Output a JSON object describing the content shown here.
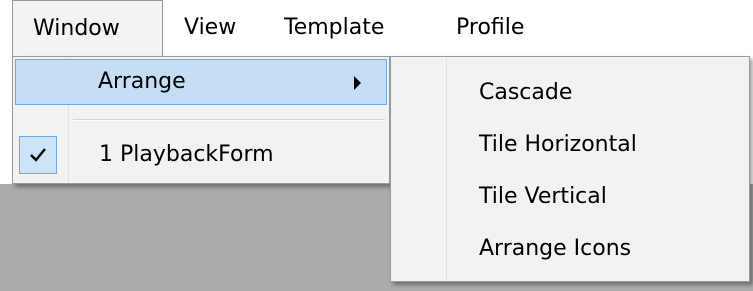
{
  "menubar": {
    "items": [
      {
        "label": "Window"
      },
      {
        "label": "View"
      },
      {
        "label": "Template"
      },
      {
        "label": "Profile"
      }
    ]
  },
  "window_menu": {
    "items": [
      {
        "label": "Arrange",
        "has_submenu": true,
        "highlighted": true
      },
      {
        "label": "1 PlaybackForm",
        "checked": true
      }
    ]
  },
  "arrange_submenu": {
    "items": [
      {
        "label": "Cascade"
      },
      {
        "label": "Tile Horizontal"
      },
      {
        "label": "Tile Vertical"
      },
      {
        "label": "Arrange Icons"
      }
    ]
  },
  "colors": {
    "highlight_fill": "#c5def5",
    "highlight_border": "#6ea8dc",
    "menu_background": "#f2f2f2",
    "client_area": "#ababab"
  }
}
